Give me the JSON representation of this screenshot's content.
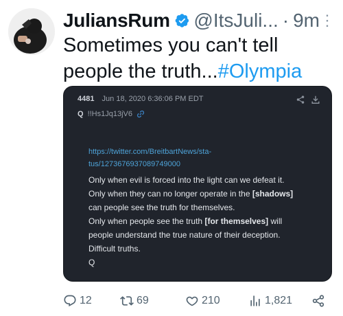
{
  "tweet": {
    "display_name": "JuliansRum",
    "handle": "@ItsJuli...",
    "separator": "·",
    "time": "9m",
    "more": "⋮",
    "text_plain": "Sometimes you can't tell people the truth...",
    "hashtag": "#Olympia"
  },
  "card": {
    "post_number": "4481",
    "post_date": "Jun 18, 2020 6:36:06 PM EDT",
    "trip_label": "Q",
    "trip_id": "!!Hs1Jq13jV6",
    "link_line1": "https://twitter.com/BreitbartNews/sta-",
    "link_line2": "tus/1273676937089749000",
    "line1": "Only when evil is forced into the light can we defeat it.",
    "line2_a": "Only when they can no longer operate in the ",
    "line2_b": "[shadows]",
    "line3": "can people see the truth for themselves.",
    "line4_a": "Only when people see the truth ",
    "line4_b": "[for themselves]",
    "line4_c": " will",
    "line5": "people understand the true nature of their deception.",
    "line6": "Difficult truths.",
    "line7": "Q"
  },
  "actions": {
    "replies": "12",
    "retweets": "69",
    "likes": "210",
    "views": "1,821"
  },
  "colors": {
    "accent": "#1d9bf0",
    "card_bg": "#20242c",
    "muted": "#536471"
  }
}
